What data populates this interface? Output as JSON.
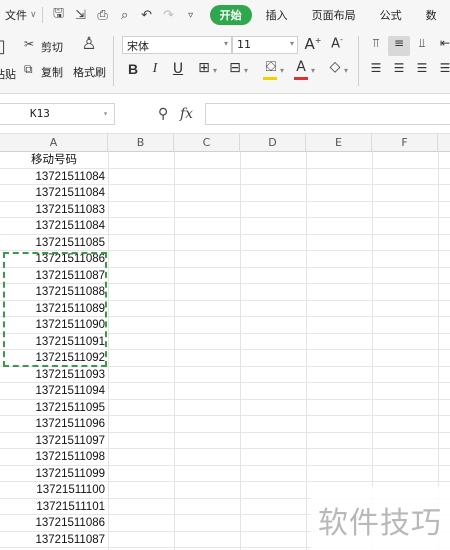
{
  "menubar": {
    "file_label": "文件",
    "tabs": [
      "开始",
      "插入",
      "页面布局",
      "公式",
      "数"
    ]
  },
  "ribbon": {
    "clipboard": {
      "cut": "剪切",
      "copy": "复制",
      "format_painter": "格式刷",
      "paste_fragment": "粘贴"
    },
    "font": {
      "name": "宋体",
      "size": "11"
    }
  },
  "formula_bar": {
    "cell_ref": "K13",
    "fx_label": "fx",
    "value": ""
  },
  "sheet": {
    "columns": [
      "A",
      "B",
      "C",
      "D",
      "E",
      "F"
    ],
    "header_cell": "移动号码",
    "rows": [
      "13721511084",
      "13721511084",
      "13721511083",
      "13721511084",
      "13721511085",
      "13721511086",
      "13721511087",
      "13721511088",
      "13721511089",
      "13721511090",
      "13721511091",
      "13721511092",
      "13721511093",
      "13721511094",
      "13721511095",
      "13721511096",
      "13721511097",
      "13721511098",
      "13721511099",
      "13721511100",
      "13721511101",
      "13721511086",
      "13721511087"
    ],
    "selection_color": "#3a9a4a"
  },
  "watermark": "软件技巧",
  "colors": {
    "accent": "#2fa74c",
    "font_color_underline": "#e03030",
    "highlight_underline": "#f5d000"
  }
}
